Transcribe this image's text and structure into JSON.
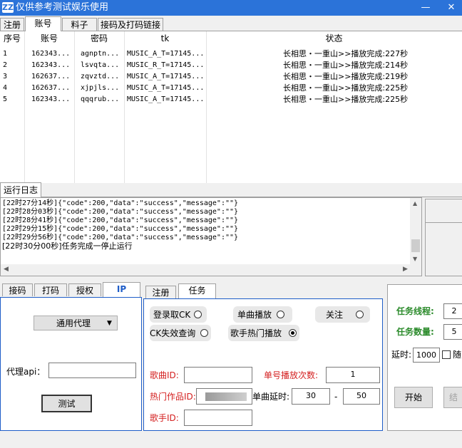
{
  "window": {
    "icon": "ZZ",
    "title": "仅供参考测试娱乐使用",
    "minimize": "—",
    "close": "✕"
  },
  "top_tabs": [
    "注册",
    "账号",
    "料子",
    "接码及打码链接"
  ],
  "table": {
    "headers": [
      "序号",
      "账号",
      "密码",
      "tk",
      "状态"
    ],
    "rows": [
      {
        "idx": "1",
        "account": "162343...",
        "password": "agnptn...",
        "tk": "MUSIC_A_T=17145...",
        "status": "长相思・一重山>>播放完成:227秒"
      },
      {
        "idx": "2",
        "account": "162343...",
        "password": "lsvqta...",
        "tk": "MUSIC_R_T=17145...",
        "status": "长相思・一重山>>播放完成:214秒"
      },
      {
        "idx": "3",
        "account": "162637...",
        "password": "zqvztd...",
        "tk": "MUSIC_A_T=17145...",
        "status": "长相思・一重山>>播放完成:219秒"
      },
      {
        "idx": "4",
        "account": "162637...",
        "password": "xjpjls...",
        "tk": "MUSIC_A_T=17145...",
        "status": "长相思・一重山>>播放完成:225秒"
      },
      {
        "idx": "5",
        "account": "162343...",
        "password": "qqqrub...",
        "tk": "MUSIC_A_T=17145...",
        "status": "长相思・一重山>>播放完成:225秒"
      }
    ]
  },
  "log": {
    "tab_label": "运行日志",
    "lines": [
      "[22时27分14秒]{\"code\":200,\"data\":\"success\",\"message\":\"\"}",
      "[22时28分03秒]{\"code\":200,\"data\":\"success\",\"message\":\"\"}",
      "[22时28分41秒]{\"code\":200,\"data\":\"success\",\"message\":\"\"}",
      "[22时29分15秒]{\"code\":200,\"data\":\"success\",\"message\":\"\"}",
      "[22时29分56秒]{\"code\":200,\"data\":\"success\",\"message\":\"\"}",
      "[22时30分00秒]任务完成一停止运行"
    ]
  },
  "left_panel": {
    "tabs": [
      "接码",
      "打码",
      "授权",
      "IP"
    ],
    "proxy_select": "通用代理",
    "proxy_api_label": "代理api：",
    "proxy_api_value": "",
    "test_button": "测试"
  },
  "middle_panel": {
    "tabs": [
      "注册",
      "任务"
    ],
    "radios": {
      "login_ck": "登录取CK",
      "single_play": "单曲播放",
      "follow": "关注",
      "ck_check": "CK失效查询",
      "singer_hot": "歌手热门播放"
    },
    "song_id_label": "歌曲ID:",
    "song_id_value": "",
    "hot_work_label": "热门作品ID:",
    "singer_id_label": "歌手ID:",
    "singer_id_value": "",
    "play_count_label": "单号播放次数:",
    "play_count_value": "1",
    "delay_label": "单曲延时:",
    "delay_min": "30",
    "delay_sep": "-",
    "delay_max": "50"
  },
  "right_panel": {
    "threads_label": "任务线程:",
    "threads_value": "2",
    "tasks_label": "任务数量:",
    "tasks_value": "5",
    "delay_label": "延时:",
    "delay_value": "1000",
    "random_label": "随",
    "start_button": "开始",
    "end_button": "结"
  },
  "colors": {
    "titlebar": "#2b73d9",
    "accent_red": "#d42020",
    "accent_green": "#2a8a2a",
    "panel_border": "#1e5dc8"
  }
}
